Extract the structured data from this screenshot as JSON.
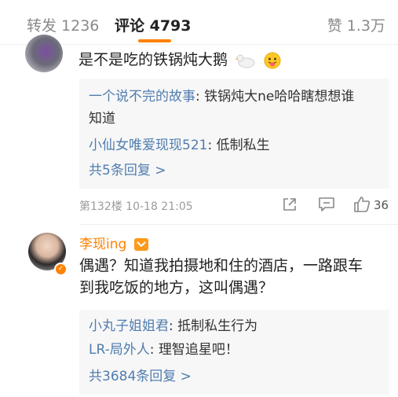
{
  "tabs": {
    "repost": "转发 1236",
    "comment": "评论 4793",
    "like": "赞 1.3万"
  },
  "comments": [
    {
      "text": "是不是吃的铁锅炖大鹅",
      "emojis": [
        "goose-emoji",
        "tongue-out-emoji"
      ],
      "replies": [
        {
          "user": "一个说不完的故事",
          "text": "铁锅炖大ne哈哈瞎想想谁"
        },
        {
          "user": "",
          "text": "知道"
        },
        {
          "user": "小仙女唯爱现现521",
          "text": "低制私生"
        }
      ],
      "more": "共5条回复 >",
      "meta": "第132楼  10-18 21:05",
      "likes": "36"
    },
    {
      "username": "李现ing",
      "text_line1": "偶遇？知道我拍摄地和住的酒店，一路跟车",
      "text_line2": "到我吃饭的地方，这叫偶遇？",
      "replies": [
        {
          "user": "小丸子姐姐君",
          "text": "抵制私生行为"
        },
        {
          "user": "LR-局外人",
          "text": "理智追星吧！"
        }
      ],
      "more": "共3684条回复 >"
    }
  ],
  "colors": {
    "accent": "#ff8200",
    "link": "#507daf",
    "reply_bg": "#f7f7f7"
  }
}
